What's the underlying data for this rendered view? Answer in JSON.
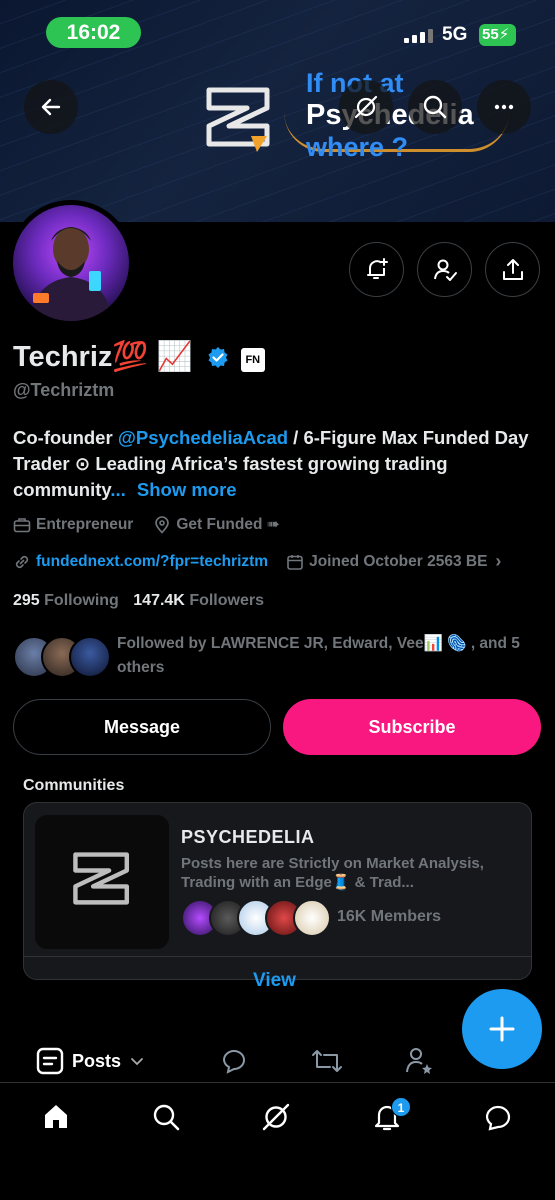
{
  "status_bar": {
    "time": "16:02",
    "network": "5G",
    "battery": "55"
  },
  "banner": {
    "line1": "If not at",
    "line2": "Psychedelia",
    "line3": "where ?"
  },
  "profile": {
    "display_name": "Techriz💯 📈",
    "verified_badge_color": "#1d9bf0",
    "affiliate_badge": "FN",
    "handle": "@Techriztm",
    "bio": {
      "prefix": "Co-founder ",
      "mention": "@PsychedeliaAcad",
      "rest": " / 6-Figure Max Funded Day Trader ⊙ Leading Africa’s fastest growing trading community",
      "ellipsis": "...",
      "show_more": "Show more"
    },
    "category": "Entrepreneur",
    "location": "Get Funded ➠",
    "website": "fundednext.com/?fpr=techriztm",
    "joined": "Joined October 2563 BE",
    "following_count": "295",
    "following_label": "Following",
    "followers_count": "147.4K",
    "followers_label": "Followers",
    "followed_by": "Followed by LAWRENCE JR, Edward, Vee📊 🫆 , and 5 others"
  },
  "actions": {
    "message": "Message",
    "subscribe": "Subscribe"
  },
  "communities": {
    "title": "Communities",
    "name": "PSYCHEDELIA",
    "description": "Posts here are Strictly on Market Analysis, Trading with an Edge🧵 & Trad...",
    "members": "16K Members",
    "view": "View"
  },
  "tabs": {
    "posts": "Posts"
  },
  "nav": {
    "notification_count": "1"
  },
  "colors": {
    "accent": "#1d9bf0",
    "subscribe": "#f91880",
    "status_green": "#2ec454"
  }
}
